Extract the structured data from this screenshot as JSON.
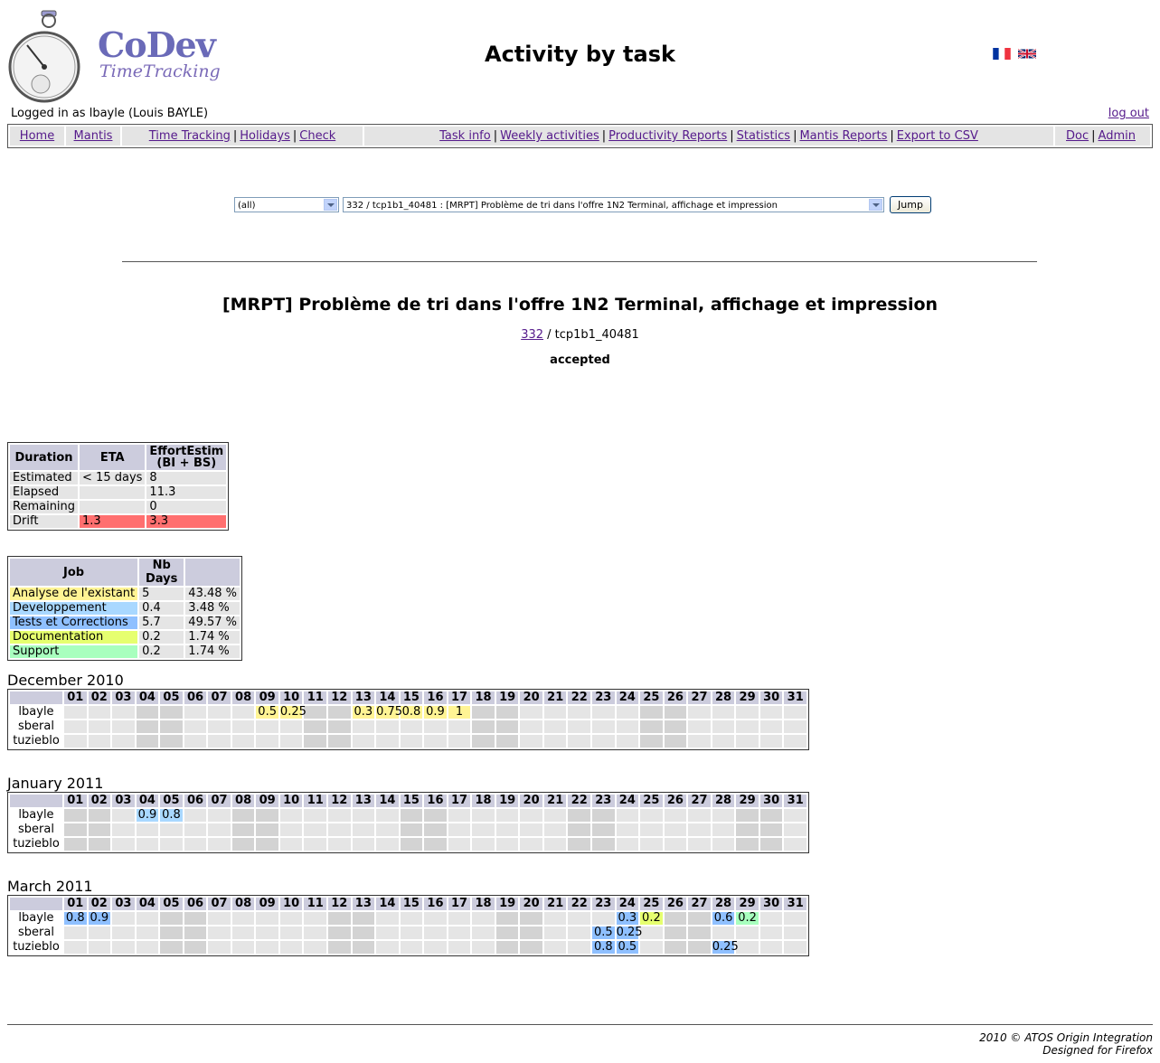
{
  "brand": {
    "name": "CoDev",
    "subtitle": "TimeTracking"
  },
  "page_title": "Activity by task",
  "user": {
    "logged_in_text": "Logged in as lbayle (Louis BAYLE)",
    "logout_label": "log out"
  },
  "menu": {
    "home": "Home",
    "mantis": "Mantis",
    "time_tracking": "Time Tracking",
    "holidays": "Holidays",
    "check": "Check",
    "task_info": "Task info",
    "weekly": "Weekly activities",
    "productivity": "Productivity Reports",
    "statistics": "Statistics",
    "mantis_reports": "Mantis Reports",
    "export_csv": "Export to CSV",
    "doc": "Doc",
    "admin": "Admin",
    "sep": "|"
  },
  "form": {
    "project_select": "(all)",
    "task_select": "332 / tcp1b1_40481 : [MRPT] Problème de tri dans l'offre 1N2 Terminal, affichage et impression",
    "jump_label": "Jump"
  },
  "task": {
    "title": "[MRPT] Problème de tri dans l'offre 1N2 Terminal, affichage et impression",
    "id_link": "332",
    "ref_rest": " / tcp1b1_40481",
    "status": "accepted"
  },
  "duration_table": {
    "headers": [
      "Duration",
      "ETA",
      "EffortEstim",
      "(BI + BS)"
    ],
    "rows": [
      [
        "Estimated",
        "< 15 days",
        "8"
      ],
      [
        "Elapsed",
        "",
        "11.3"
      ],
      [
        "Remaining",
        "",
        "0"
      ],
      [
        "Drift",
        "1.3",
        "3.3"
      ]
    ]
  },
  "job_table": {
    "headers": [
      "Job",
      "Nb Days",
      ""
    ],
    "rows": [
      [
        "Analyse de l'existant",
        "5",
        "43.48 %"
      ],
      [
        "Developpement",
        "0.4",
        "3.48 %"
      ],
      [
        "Tests et Corrections",
        "5.7",
        "49.57 %"
      ],
      [
        "Documentation",
        "0.2",
        "1.74 %"
      ],
      [
        "Support",
        "0.2",
        "1.74 %"
      ]
    ],
    "colors": [
      "#fff494",
      "#a9d8ff",
      "#8fc0ff",
      "#e6ff6f",
      "#a8ffbe"
    ]
  },
  "users": [
    "lbayle",
    "sberal",
    "tuzieblo"
  ],
  "months": [
    {
      "label": "December 2010",
      "weekends": [
        4,
        5,
        11,
        12,
        18,
        19,
        25,
        26
      ],
      "values": {
        "lbayle": {
          "9": [
            "0.5",
            "analyse"
          ],
          "10": [
            "0.25",
            "analyse"
          ],
          "13": [
            "0.3",
            "analyse"
          ],
          "14": [
            "0.75",
            "analyse"
          ],
          "15": [
            "0.8",
            "analyse"
          ],
          "16": [
            "0.9",
            "analyse"
          ],
          "17": [
            "1",
            "analyse"
          ]
        },
        "sberal": {},
        "tuzieblo": {}
      }
    },
    {
      "label": "January 2011",
      "weekends": [
        1,
        2,
        8,
        9,
        15,
        16,
        22,
        23,
        29,
        30
      ],
      "values": {
        "lbayle": {
          "4": [
            "0.9",
            "dev"
          ],
          "5": [
            "0.8",
            "dev"
          ]
        },
        "sberal": {},
        "tuzieblo": {}
      }
    },
    {
      "label": "March 2011",
      "weekends": [
        5,
        6,
        12,
        13,
        19,
        20,
        26,
        27
      ],
      "values": {
        "lbayle": {
          "1": [
            "0.8",
            "tests"
          ],
          "2": [
            "0.9",
            "tests"
          ],
          "24": [
            "0.3",
            "tests"
          ],
          "25": [
            "0.2",
            "doc"
          ],
          "28": [
            "0.6",
            "tests"
          ],
          "29": [
            "0.2",
            "support"
          ]
        },
        "sberal": {
          "23": [
            "0.5",
            "tests"
          ],
          "24": [
            "0.25",
            "tests"
          ]
        },
        "tuzieblo": {
          "23": [
            "0.8",
            "tests"
          ],
          "24": [
            "0.5",
            "tests"
          ],
          "28": [
            "0.25",
            "tests"
          ]
        }
      }
    }
  ],
  "footer": {
    "line1": "2010 © ATOS Origin Integration",
    "line2": "Designed for Firefox"
  }
}
